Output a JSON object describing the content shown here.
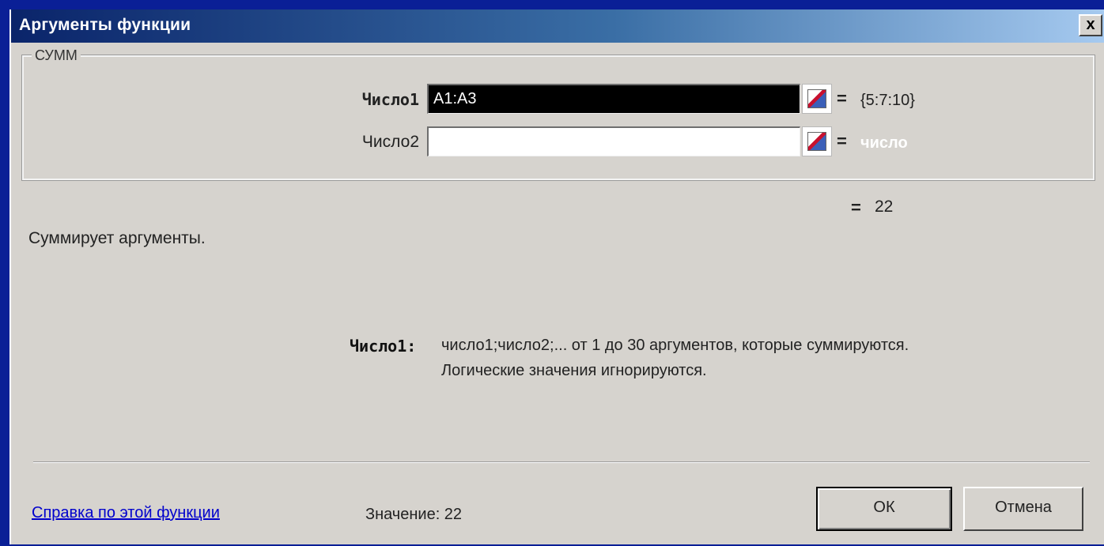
{
  "window": {
    "title": "Аргументы функции",
    "close_label": "x"
  },
  "function": {
    "name": "СУММ"
  },
  "arguments": [
    {
      "label": "Число1",
      "value": "A1:A3",
      "result": "{5:7:10}"
    },
    {
      "label": "Число2",
      "value": "",
      "result": "число"
    }
  ],
  "equals_sign": "=",
  "total": "22",
  "description": "Суммирует аргументы.",
  "help": {
    "label": "Число1:",
    "line1": "число1;число2;... от 1 до 30 аргументов, которые суммируются.",
    "line2": "Логические значения игнорируются."
  },
  "footer": {
    "help_link": "Справка по этой функции",
    "value_label": "Значение: 22",
    "ok_label": "ОК",
    "cancel_label": "Отмена"
  },
  "colors": {
    "background": "#0a1f96",
    "dialog": "#d6d3ce",
    "title_start": "#0a246a",
    "link": "#0000cc"
  }
}
